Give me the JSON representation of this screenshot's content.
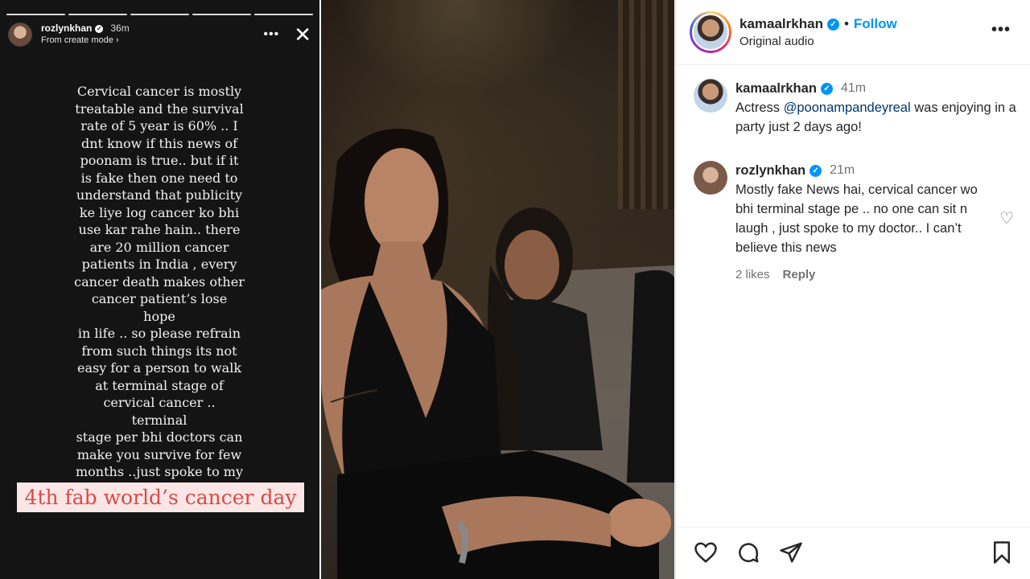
{
  "story": {
    "username": "rozlynkhan",
    "time": "36m",
    "subtitle": "From create mode",
    "text": "Cervical cancer is mostly\ntreatable and the survival\nrate of 5 year is 60% .. I\ndnt know if this news of\npoonam  is true.. but if it\nis  fake then one need to\nunderstand that publicity\nke liye log cancer ko bhi\nuse kar rahe hain.. there\nare 20 million cancer\npatients in India , every\ncancer death makes other\ncancer patient’s lose hope\nin life .. so please refrain\nfrom such things its not\neasy for a person to walk\nat terminal stage of\ncervical cancer .. terminal\nstage  per bhi doctors can\nmake you survive for few\nmonths ..just spoke to my\ndoctor",
    "tag": "4th fab world’s cancer day",
    "progress_segments": 5
  },
  "post": {
    "username": "kamaalrkhan",
    "separator": "•",
    "follow_label": "Follow",
    "audio": "Original audio",
    "comments": [
      {
        "username": "kamaalrkhan",
        "time": "41m",
        "text_before": "Actress ",
        "mention": "@poonampandeyreal",
        "text_after": " was enjoying in a party just 2 days ago!"
      },
      {
        "username": "rozlynkhan",
        "time": "21m",
        "text": "Mostly fake News hai, cervical cancer wo bhi terminal stage pe .. no one can sit n laugh , just spoke to my doctor.. I can’t believe this news",
        "likes": "2 likes",
        "reply_label": "Reply"
      }
    ]
  },
  "colors": {
    "story_bg": "#141414",
    "tag_bg": "#fbe6e6",
    "tag_text": "#d94a4a",
    "accent_blue": "#0095f6"
  },
  "icons": [
    "dots-icon",
    "close-icon",
    "verified-icon",
    "more-icon",
    "heart-icon",
    "comment-icon",
    "share-icon",
    "bookmark-icon"
  ]
}
